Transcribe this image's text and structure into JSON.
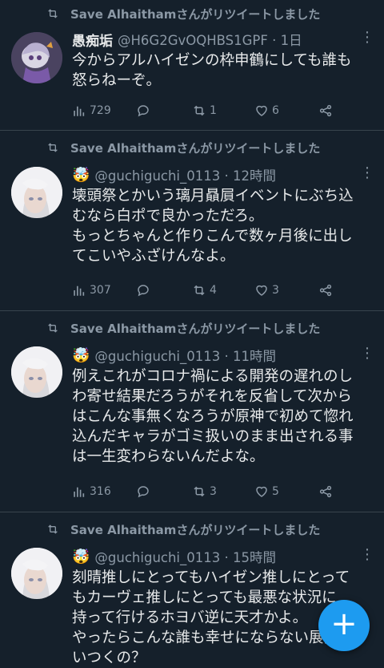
{
  "tweets": [
    {
      "retweet_text": "Save Alhaithamさんがリツイートしました",
      "name": "愚痴垢",
      "handle_time": "@H6G2GvOQHBS1GPF · 1日",
      "lines": [
        "今からアルハイゼンの枠申鶴にしても誰も",
        "怒らねーぞ。"
      ],
      "views": "729",
      "retweets": "1",
      "likes": "6",
      "avatar": "anime-character-avatar"
    },
    {
      "retweet_text": "Save Alhaithamさんがリツイートしました",
      "emoji": "🤯",
      "handle_time": "@guchiguchi_0113 · 12時間",
      "lines": [
        "壊頭祭とかいう璃月贔屓イベントにぶち込",
        "むなら白ポで良かっただろ。",
        "もっとちゃんと作りこんで数ヶ月後に出し",
        "てこいやふざけんなよ。"
      ],
      "views": "307",
      "retweets": "4",
      "likes": "3",
      "avatar": "white-haired-girl-avatar"
    },
    {
      "retweet_text": "Save Alhaithamさんがリツイートしました",
      "emoji": "🤯",
      "handle_time": "@guchiguchi_0113 · 11時間",
      "lines": [
        "例えこれがコロナ禍による開発の遅れのし",
        "わ寄せ結果だろうがそれを反省して次から",
        "はこんな事無くなろうが原神で初めて惚れ",
        "込んだキャラがゴミ扱いのまま出される事",
        "は一生変わらないんだよな。"
      ],
      "views": "316",
      "retweets": "3",
      "likes": "5",
      "avatar": "white-haired-girl-avatar"
    },
    {
      "retweet_text": "Save Alhaithamさんがリツイートしました",
      "emoji": "🤯",
      "handle_time": "@guchiguchi_0113 · 15時間",
      "lines": [
        "刻晴推しにとってもハイゼン推しにとって",
        "もカーヴェ推しにとっても最悪な状況に",
        "持って行けるホヨバ逆に天才かよ。",
        "やったらこんな誰も幸せにならない展開思",
        "いつくの？"
      ],
      "avatar": "white-haired-girl-avatar"
    }
  ],
  "icons": {
    "retweet": "retweet-icon",
    "more": "more-icon",
    "views": "views-icon",
    "reply": "reply-icon",
    "like": "like-icon",
    "share": "share-icon",
    "compose": "plus-icon"
  },
  "colors": {
    "background": "#15202b",
    "text": "#e7e9ea",
    "secondary": "#8b98a5",
    "divider": "#38444d",
    "accent": "#1d9bf0"
  },
  "fab_label": "+"
}
